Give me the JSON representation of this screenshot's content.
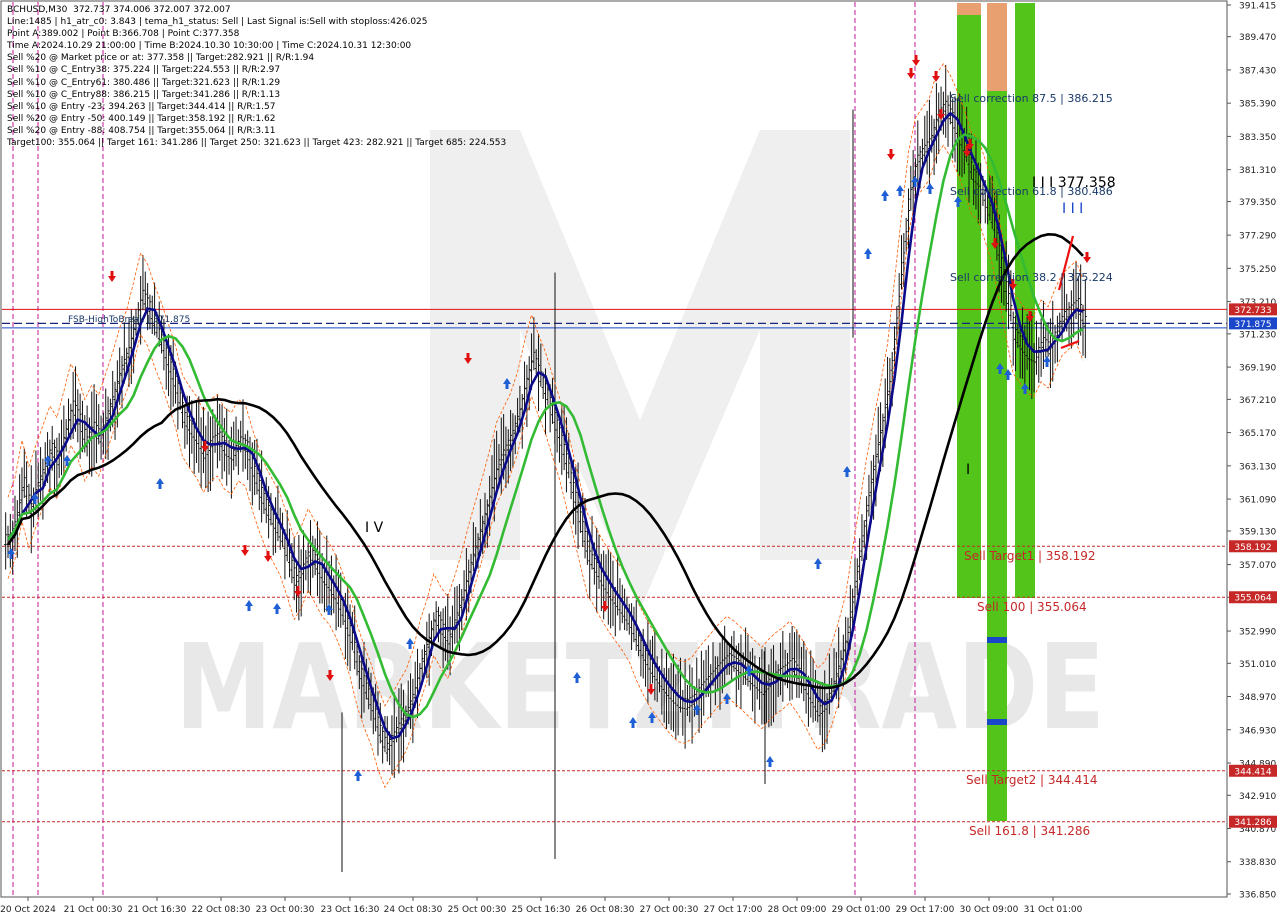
{
  "header": {
    "lines": [
      "BCHUSD,M30  372.737 374.006 372.007 372.007",
      "Line:1485 | h1_atr_c0: 3.843 | tema_h1_status: Sell | Last Signal is:Sell with stoploss:426.025",
      "Point A:389.002 | Point B:366.708 | Point C:377.358",
      "Time A:2024.10.29 21:00:00 | Time B:2024.10.30 10:30:00 | Time C:2024.10.31 12:30:00",
      "Sell %20 @ Market price or at: 377.358 || Target:282.921 || R/R:1.94",
      "Sell %10 @ C_Entry38: 375.224 || Target:224.553 || R/R:2.97",
      "Sell %10 @ C_Entry61: 380.486 || Target:321.623 || R/R:1.29",
      "Sell %10 @ C_Entry88: 386.215 || Target:341.286 || R/R:1.13",
      "Sell %10 @ Entry -23: 394.263 || Target:344.414 || R/R:1.57",
      "Sell %20 @ Entry -50: 400.149 || Target:358.192 || R/R:1.62",
      "Sell %20 @ Entry -88: 408.754 || Target:355.064 || R/R:3.11",
      "Target100: 355.064 || Target 161: 341.286 || Target 250: 321.623 || Target 423: 282.921 || Target 685: 224.553"
    ]
  },
  "colors": {
    "grid_red": "#c62828",
    "blue_dash": "#1a237e",
    "green_zone": "#52c41a",
    "orange_zone": "#e8a070",
    "tema": "#0a0a8a",
    "ma_green": "#33bb33",
    "ma_black": "#000000",
    "arrow_up": "#1f5fd6",
    "arrow_down": "#e01010",
    "price_tag": "#c62828",
    "blue_tag": "#1a47c9",
    "watermark": "#e8e8e8"
  },
  "chart_data": {
    "type": "candlestick",
    "symbol": "BCHUSD",
    "timeframe": "M30",
    "ylim": [
      336.85,
      391.415
    ],
    "y_ticks": [
      "391.415",
      "389.470",
      "387.430",
      "385.390",
      "383.350",
      "381.310",
      "379.350",
      "377.290",
      "375.250",
      "373.210",
      "371.230",
      "369.190",
      "367.210",
      "365.170",
      "363.130",
      "361.090",
      "359.130",
      "357.070",
      "355.064",
      "352.990",
      "351.010",
      "348.970",
      "346.930",
      "344.890",
      "342.910",
      "340.870",
      "338.830",
      "336.850"
    ],
    "x_ticks": [
      "20 Oct 2024",
      "21 Oct 00:30",
      "21 Oct 16:30",
      "22 Oct 08:30",
      "23 Oct 00:30",
      "23 Oct 16:30",
      "24 Oct 08:30",
      "25 Oct 00:30",
      "25 Oct 16:30",
      "26 Oct 08:30",
      "27 Oct 00:30",
      "27 Oct 17:00",
      "28 Oct 09:00",
      "29 Oct 01:00",
      "29 Oct 17:00",
      "30 Oct 09:00",
      "31 Oct 01:00"
    ],
    "price_tags": [
      {
        "value": 372.733,
        "label": "372.733",
        "color": "red"
      },
      {
        "value": 371.875,
        "label": "371.875",
        "color": "blue"
      },
      {
        "value": 358.192,
        "label": "358.192",
        "color": "red"
      },
      {
        "value": 355.064,
        "label": "355.064",
        "color": "red"
      },
      {
        "value": 344.414,
        "label": "344.414",
        "color": "red"
      },
      {
        "value": 341.286,
        "label": "341.286",
        "color": "red"
      }
    ],
    "levels": [
      {
        "label": "Sell correction 87.5 | 386.215",
        "value": 386.215
      },
      {
        "label": "Sell correction 61.8 | 380.486",
        "value": 380.486
      },
      {
        "label": "Sell correction 38.2 | 375.224",
        "value": 375.224
      },
      {
        "label": "Sell Target1 | 358.192",
        "value": 358.192
      },
      {
        "label": "Sell 100 | 355.064",
        "value": 355.064
      },
      {
        "label": "Sell Target2 | 344.414",
        "value": 344.414
      },
      {
        "label": "Sell 161.8 | 341.286",
        "value": 341.286
      }
    ],
    "fsb_label": "FSB-HighToBreak | 371.875",
    "wave_labels": {
      "iv": "I V",
      "i_low": "I",
      "iii": "I I I",
      "iii_top": "I I I 377.358"
    },
    "close_series": [
      358.6,
      359.8,
      362.1,
      360.5,
      361.8,
      363.0,
      364.2,
      363.5,
      365.1,
      366.8,
      366.0,
      364.6,
      365.5,
      364.9,
      366.2,
      367.5,
      369.0,
      370.1,
      371.8,
      373.6,
      372.9,
      371.6,
      370.5,
      369.2,
      367.9,
      366.1,
      365.4,
      364.8,
      363.9,
      364.6,
      364.9,
      364.1,
      363.8,
      364.6,
      364.3,
      362.8,
      361.5,
      360.4,
      359.6,
      358.8,
      357.5,
      356.1,
      356.8,
      357.9,
      357.1,
      356.3,
      355.8,
      355.0,
      353.9,
      352.6,
      350.8,
      349.5,
      348.4,
      346.9,
      345.8,
      346.5,
      347.3,
      348.0,
      349.2,
      351.0,
      352.3,
      353.9,
      353.1,
      352.5,
      353.8,
      355.2,
      356.9,
      358.4,
      359.9,
      361.5,
      363.2,
      364.1,
      365.0,
      366.3,
      368.2,
      369.8,
      368.6,
      367.5,
      366.1,
      364.7,
      363.0,
      361.2,
      359.4,
      357.6,
      356.9,
      356.1,
      355.4,
      354.8,
      354.2,
      353.5,
      352.4,
      351.5,
      350.7,
      350.1,
      349.5,
      349.0,
      348.6,
      348.5,
      348.8,
      349.4,
      349.9,
      350.4,
      350.9,
      351.3,
      351.0,
      350.6,
      350.2,
      349.8,
      349.4,
      349.9,
      350.3,
      350.6,
      351.0,
      350.4,
      349.7,
      348.9,
      348.1,
      348.5,
      349.6,
      351.0,
      352.6,
      355.4,
      358.2,
      361.0,
      363.4,
      365.6,
      368.0,
      371.9,
      375.9,
      379.8,
      381.9,
      382.5,
      383.1,
      384.6,
      385.2,
      384.5,
      383.5,
      382.4,
      381.0,
      380.6,
      379.3,
      377.9,
      375.6,
      373.4,
      371.2,
      370.6,
      370.0,
      369.8,
      370.7,
      370.3,
      371.4,
      372.3,
      372.7,
      373.1,
      372.0
    ]
  },
  "watermark": "MARKETZITRADE"
}
